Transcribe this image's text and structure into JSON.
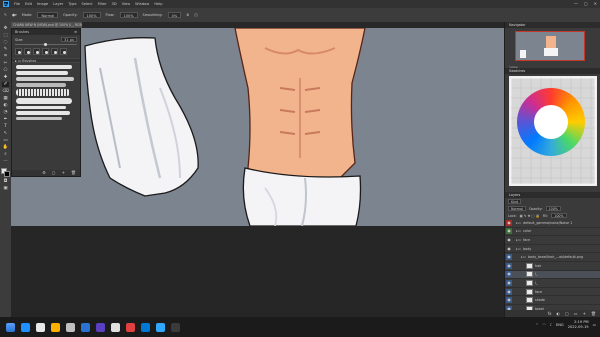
{
  "app": {
    "logo": "Ps",
    "menu": [
      "File",
      "Edit",
      "Image",
      "Layer",
      "Type",
      "Select",
      "Filter",
      "3D",
      "View",
      "Window",
      "Help"
    ],
    "window_controls": [
      "—",
      "▢",
      "✕"
    ]
  },
  "options_bar": {
    "mode_label": "Mode:",
    "mode_value": "Normal",
    "opacity_label": "Opacity:",
    "opacity_value": "100%",
    "flow_label": "Flow:",
    "flow_value": "100%",
    "smoothing_label": "Smoothing:",
    "smoothing_value": "0%"
  },
  "document_tab": {
    "title": "CHARA NEW N (NSW).psd @ 100% (l_, RGB/8)"
  },
  "tools": [
    "✥",
    "⬚",
    "◌",
    "✎",
    "⌗",
    "✂",
    "⎔",
    "✚",
    "✐",
    "⌫",
    "▦",
    "◐",
    "◔",
    "✒",
    "T",
    "↖",
    "▭",
    "✋",
    "⌕",
    "⋯"
  ],
  "brush_panel": {
    "title": "Brushes",
    "size_label": "Size:",
    "size_value": "31 px",
    "folder_label": "Brushes",
    "footer_icons": [
      "⚙",
      "▢",
      "+",
      "🗑"
    ],
    "preset_count": 6,
    "stroke_count": 9
  },
  "right_panels": {
    "navigator_title": "Navigator",
    "navigator_zoom": "100%",
    "swatches_title": "Swatches",
    "layers_title": "Layers",
    "layers_kind": "Kind",
    "layers_blend": "Normal",
    "layers_opacity_label": "Opacity:",
    "layers_opacity": "100%",
    "layers_lock_label": "Lock:",
    "layers_fill_label": "Fill:",
    "layers_fill": "100%",
    "layer_rows": [
      {
        "name": "default_gamma/noise/Noise 1",
        "eye": "red",
        "indent": 0
      },
      {
        "name": "color",
        "eye": "green",
        "indent": 0
      },
      {
        "name": "face",
        "eye": "normal",
        "indent": 0
      },
      {
        "name": "body",
        "eye": "normal",
        "indent": 0
      },
      {
        "name": "body_towel/hair_...ok/default.png",
        "eye": "blue",
        "indent": 1
      },
      {
        "name": "hair",
        "eye": "blue",
        "indent": 2
      },
      {
        "name": "l_",
        "eye": "blue",
        "indent": 2,
        "selected": true
      },
      {
        "name": "l_",
        "eye": "blue",
        "indent": 2
      },
      {
        "name": "face",
        "eye": "blue",
        "indent": 2
      },
      {
        "name": "shade",
        "eye": "blue",
        "indent": 2
      },
      {
        "name": "towel",
        "eye": "blue",
        "indent": 2
      },
      {
        "name": "body_towel/hair_...ok/default.png",
        "eye": "green",
        "indent": 1
      }
    ],
    "layers_footer": [
      "fx",
      "◐",
      "▢",
      "▭",
      "+",
      "🗑"
    ]
  },
  "taskbar": {
    "icons": [
      "#1e90ff",
      "#e8e8e8",
      "#ffb000",
      "#c0c0c0",
      "#2a73d0",
      "#5a3fc0",
      "#e0e0e0",
      "#e04040",
      "#0078d4",
      "#31a8ff",
      "#3a3a3a"
    ],
    "tray_lang": "ENG",
    "time": "2:19 PM",
    "date": "2022-09-19"
  },
  "colors": {
    "canvas_bg": "#7c8490",
    "skin": "#f2b48c",
    "towel": "#f4f4f6",
    "accent": "#31a8ff"
  }
}
